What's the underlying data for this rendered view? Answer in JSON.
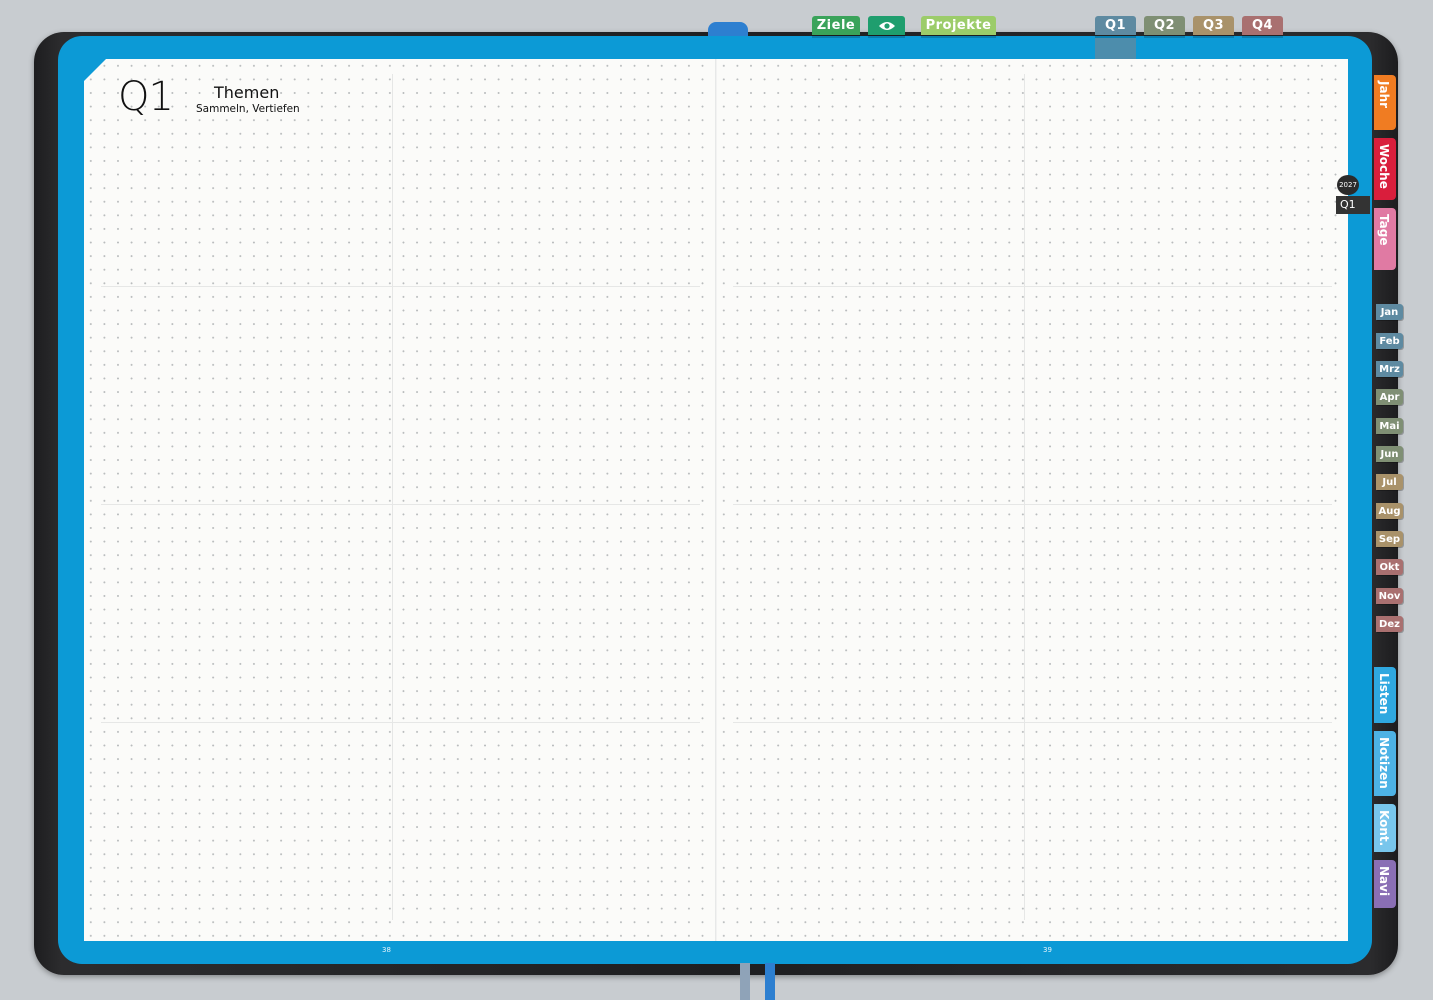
{
  "page_left": {
    "quarter_label": "Q1",
    "section_title": "Themen",
    "section_subtitle": "Sammeln, Vertiefen",
    "page_number": "38"
  },
  "page_right": {
    "page_number": "39"
  },
  "top_tabs": [
    {
      "label": "Ziele",
      "color": "#3aa35a"
    },
    {
      "label": "eye-icon",
      "color": "#1f9e6e"
    },
    {
      "label": "Projekte",
      "color": "#9ccc6a"
    },
    {
      "label": "Q1",
      "color": "#5e8aa1"
    },
    {
      "label": "Q2",
      "color": "#7f8f74"
    },
    {
      "label": "Q3",
      "color": "#a9926a"
    },
    {
      "label": "Q4",
      "color": "#a97070"
    }
  ],
  "side_tabs_top": [
    {
      "label": "Jahr",
      "color": "#f07c22"
    },
    {
      "label": "Woche",
      "color": "#d91e3c"
    },
    {
      "label": "Tage",
      "color": "#e07aa3"
    }
  ],
  "year_badge": "2027",
  "quarter_badge": "Q1",
  "month_tabs": [
    {
      "label": "Jan",
      "color": "#5e8aa1"
    },
    {
      "label": "Feb",
      "color": "#5e8aa1"
    },
    {
      "label": "Mrz",
      "color": "#5e8aa1"
    },
    {
      "label": "Apr",
      "color": "#7f8f74"
    },
    {
      "label": "Mai",
      "color": "#7f8f74"
    },
    {
      "label": "Jun",
      "color": "#7f8f74"
    },
    {
      "label": "Jul",
      "color": "#a9926a"
    },
    {
      "label": "Aug",
      "color": "#a9926a"
    },
    {
      "label": "Sep",
      "color": "#a9926a"
    },
    {
      "label": "Okt",
      "color": "#a97070"
    },
    {
      "label": "Nov",
      "color": "#a97070"
    },
    {
      "label": "Dez",
      "color": "#a97070"
    }
  ],
  "side_tabs_bottom": [
    {
      "label": "Listen",
      "color": "#2fa8e0"
    },
    {
      "label": "Notizen",
      "color": "#4db2e5"
    },
    {
      "label": "Kont.",
      "color": "#78c6ec"
    },
    {
      "label": "Navi",
      "color": "#8a6fb5"
    }
  ]
}
